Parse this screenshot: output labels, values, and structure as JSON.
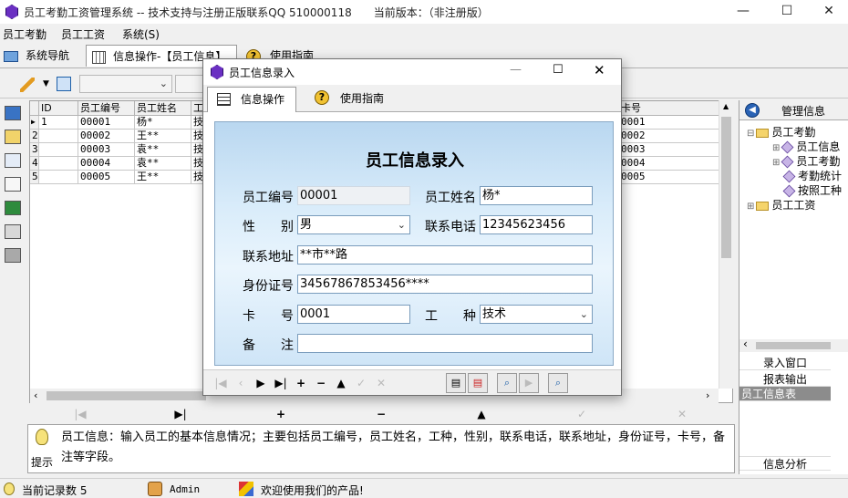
{
  "window": {
    "title": "员工考勤工资管理系统 -- 技术支持与注册正版联系QQ 510000118　　当前版本：（非注册版）",
    "minimize": "—",
    "maximize": "☐",
    "close": "✕"
  },
  "menu": [
    "员工考勤",
    "员工工资",
    "系统(S)"
  ],
  "main_tabs": [
    "系统导航",
    "信息操作-【员工信息】",
    "使用指南"
  ],
  "grid": {
    "columns": [
      "ID",
      "员工编号",
      "员工姓名",
      "工",
      "卡号"
    ],
    "rows": [
      {
        "num": "",
        "id": "1",
        "code": "00001",
        "name": "杨*",
        "type": "技",
        "card": "0001"
      },
      {
        "num": "2",
        "id": "",
        "code": "00002",
        "name": "王**",
        "type": "技",
        "card": "0002"
      },
      {
        "num": "3",
        "id": "",
        "code": "00003",
        "name": "袁**",
        "type": "技",
        "card": "0003"
      },
      {
        "num": "4",
        "id": "",
        "code": "00004",
        "name": "袁**",
        "type": "技",
        "card": "0004"
      },
      {
        "num": "5",
        "id": "",
        "code": "00005",
        "name": "王**",
        "type": "技",
        "card": "0005"
      }
    ]
  },
  "nav": {
    "first": "|◀",
    "last": "▶|",
    "add": "+",
    "delete": "−",
    "up": "▲",
    "post": "✓",
    "cancel": "✕"
  },
  "hint": {
    "label": "提示",
    "text": "员工信息：输入员工的基本信息情况；主要包括员工编号，员工姓名，工种，性别，联系电话，联系地址，身份证号，卡号，备注等字段。"
  },
  "right_panel": {
    "header": "管理信息",
    "tree": [
      {
        "label": "员工考勤",
        "kind": "folder"
      },
      {
        "label": "员工信息",
        "kind": "item"
      },
      {
        "label": "员工考勤",
        "kind": "item"
      },
      {
        "label": "考勤统计",
        "kind": "item"
      },
      {
        "label": "按照工种",
        "kind": "item"
      },
      {
        "label": "员工工资",
        "kind": "folder"
      }
    ],
    "links": [
      "录入窗口",
      "报表输出",
      "员工信息表"
    ],
    "footer": "信息分析"
  },
  "status": {
    "record": "当前记录数 5",
    "user": "Admin",
    "welcome": "欢迎使用我们的产品!"
  },
  "dialog": {
    "title": "员工信息录入",
    "tabs": [
      "信息操作",
      "使用指南"
    ],
    "form_title": "员工信息录入",
    "labels": {
      "code": "员工编号",
      "name": "员工姓名",
      "gender": "性　　别",
      "phone": "联系电话",
      "address": "联系地址",
      "idcard": "身份证号",
      "card": "卡　　号",
      "worktype": "工　　种",
      "note": "备　　注"
    },
    "values": {
      "code": "00001",
      "name": "杨*",
      "gender": "男",
      "phone": "12345623456",
      "address": "**市**路",
      "idcard": "34567867853456****",
      "card": "0001",
      "worktype": "技术",
      "note": ""
    }
  },
  "colors": {
    "accent": "#0a5fd0",
    "form_bg": "#cfe5f7",
    "selected_link": "#8c8c8c"
  }
}
